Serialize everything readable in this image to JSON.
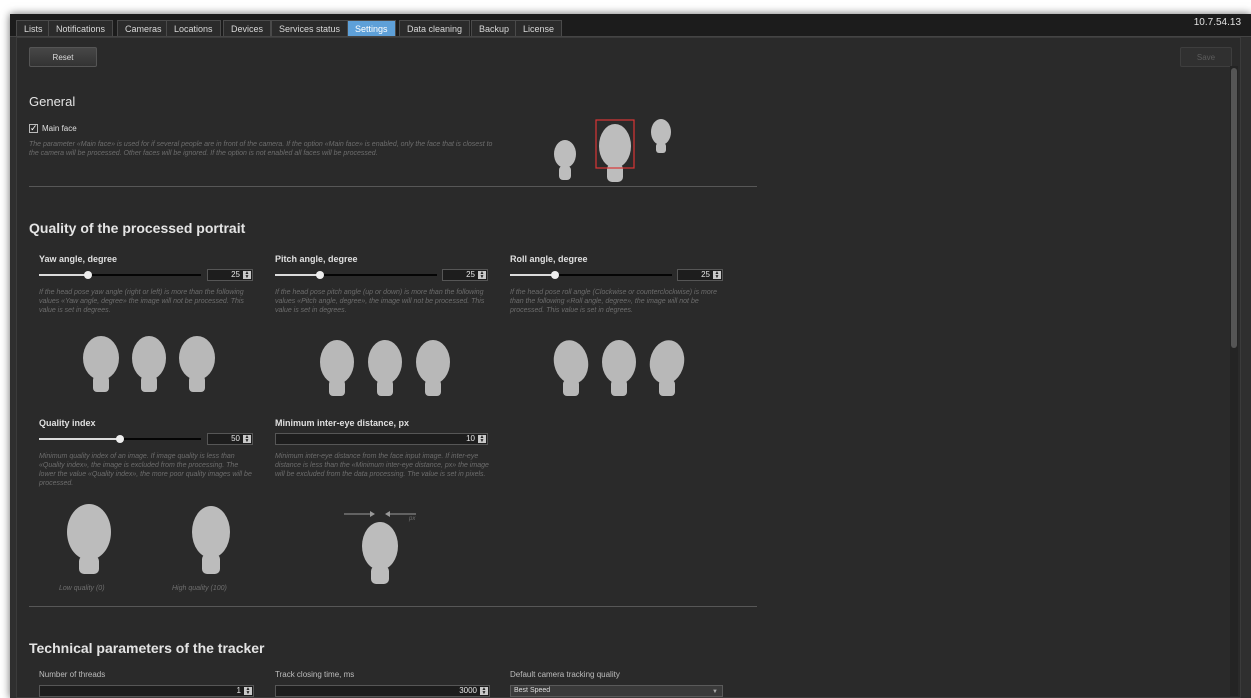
{
  "window": {
    "version": "10.7.54.13"
  },
  "tabs": [
    {
      "label": "Lists"
    },
    {
      "label": "Notifications"
    },
    {
      "label": "Cameras"
    },
    {
      "label": "Locations"
    },
    {
      "label": "Devices"
    },
    {
      "label": "Services status"
    },
    {
      "label": "Settings",
      "active": true
    },
    {
      "label": "Data cleaning"
    },
    {
      "label": "Backup"
    },
    {
      "label": "License"
    }
  ],
  "toolbar": {
    "reset_label": "Reset",
    "save_label": "Save"
  },
  "general": {
    "title": "General",
    "main_face": {
      "label": "Main face",
      "checked": true,
      "description": "The parameter «Main face» is used for if several people are in front of the camera. If the option «Main face» is enabled, only the face that is closest to the camera will be processed. Other faces will be ignored. If the option is not enabled all faces will be processed."
    }
  },
  "quality": {
    "title": "Quality of the processed portrait",
    "yaw": {
      "label": "Yaw angle, degree",
      "value": "25",
      "level": 0.3,
      "description": "If the head pose yaw angle (right or left) is more than the following values «Yaw angle, degree» the image will not be processed. This value is set in degrees."
    },
    "pitch": {
      "label": "Pitch angle, degree",
      "value": "25",
      "level": 0.28,
      "description": "If the head pose pitch angle (up or down) is more than the following values «Pitch angle, degree», the image will not be processed. This value is set in degrees."
    },
    "roll": {
      "label": "Roll angle, degree",
      "value": "25",
      "level": 0.28,
      "description": "If the head pose roll angle (Clockwise or counterclockwise) is more than the following «Roll angle, degree», the image will not be processed. This value is set in degrees."
    },
    "quality_index": {
      "label": "Quality index",
      "value": "50",
      "level": 0.5,
      "description": "Minimum quality index of an image. If image quality is less than «Quality index», the image is excluded from the processing. The lower the value «Quality index», the more poor quality images will be processed.",
      "low_caption": "Low quality (0)",
      "high_caption": "High quality (100)"
    },
    "inter_eye": {
      "label": "Minimum inter-eye distance, px",
      "value": "10",
      "description": "Minimum inter-eye distance from the face input image. If inter-eye distance is less than the «Minimum inter-eye distance, px» the image will be excluded from the data processing. The value is set in pixels.",
      "unit": "px"
    }
  },
  "tracker": {
    "title": "Technical parameters of the tracker",
    "threads": {
      "label": "Number of threads",
      "value": "1"
    },
    "closing_time": {
      "label": "Track closing time, ms",
      "value": "3000"
    },
    "camera_quality": {
      "label": "Default camera tracking quality",
      "selected": "Best Speed"
    }
  },
  "icons": {
    "check": "checkmark-icon",
    "spin": "spinner-arrows-icon",
    "caret": "dropdown-caret-icon"
  },
  "colors": {
    "accent_tab": "#5ea0d8",
    "highlight_box": "#d93636"
  }
}
